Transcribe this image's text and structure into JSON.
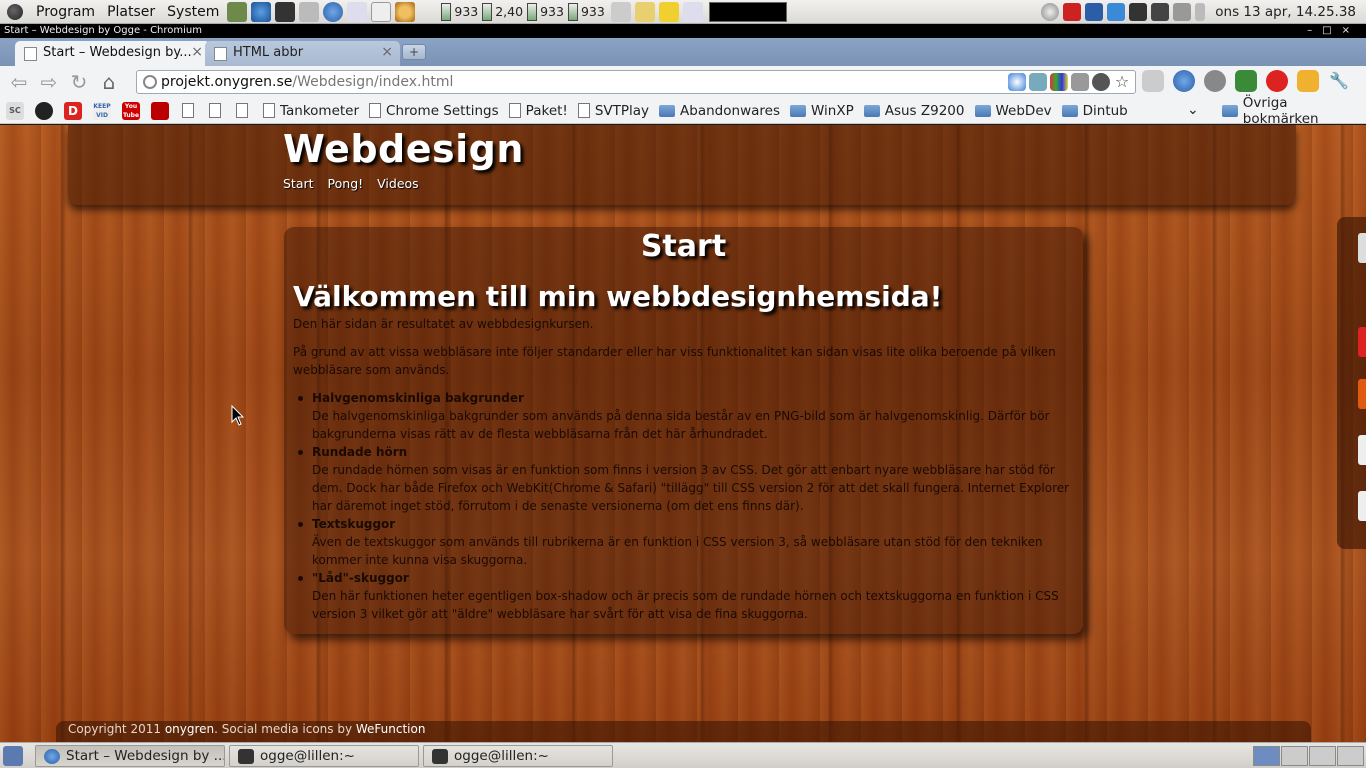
{
  "top_panel": {
    "menus": [
      "Program",
      "Platser",
      "System"
    ],
    "monitors": [
      {
        "label": "933"
      },
      {
        "label": "2,40"
      },
      {
        "label": "933"
      },
      {
        "label": "933"
      }
    ],
    "clock": "ons 13 apr, 14.25.38"
  },
  "window_title": "Start – Webdesign by Ogge - Chromium",
  "tabs": [
    {
      "label": "Start – Webdesign by...",
      "active": true
    },
    {
      "label": "HTML abbr",
      "active": false
    }
  ],
  "address_bar": {
    "host": "projekt.onygren.se",
    "path": "/Webdesign/index.html"
  },
  "bookmarks": {
    "icon_items": [
      {
        "icon": "sc-icon",
        "text": "SC"
      },
      {
        "icon": "opera-icon",
        "text": ""
      },
      {
        "icon": "d-icon",
        "text": "D"
      },
      {
        "icon": "keepvid-icon",
        "text": "KEEP VID"
      },
      {
        "icon": "youtube-icon",
        "text": "You Tube"
      },
      {
        "icon": "shield-icon",
        "text": ""
      }
    ],
    "items": [
      {
        "label": "Tankometer",
        "type": "page"
      },
      {
        "label": "Chrome Settings",
        "type": "page"
      },
      {
        "label": "Paket!",
        "type": "page"
      },
      {
        "label": "SVTPlay",
        "type": "page"
      },
      {
        "label": "Abandonwares",
        "type": "folder"
      },
      {
        "label": "WinXP",
        "type": "folder"
      },
      {
        "label": "Asus Z9200",
        "type": "folder"
      },
      {
        "label": "WebDev",
        "type": "folder"
      },
      {
        "label": "Dintub",
        "type": "folder"
      }
    ],
    "other": "Övriga bokmärken"
  },
  "site": {
    "title": "Webdesign",
    "nav": [
      "Start",
      "Pong!",
      "Videos"
    ],
    "heading": "Start",
    "welcome": "Välkommen till min webbdesignhemsida!",
    "intro": "Den här sidan är resultatet av webbdesignkursen.",
    "paragraph": "På grund av att vissa webbläsare inte följer standarder eller har viss funktionalitet kan sidan visas lite olika beroende på vilken webbläsare som används.",
    "features": [
      {
        "term": "Halvgenomskinliga bakgrunder",
        "desc": "De halvgenomskinliga bakgrunder som används på denna sida består av en PNG-bild som är halvgenomskinlig. Därför bör bakgrunderna visas rätt av de flesta webbläsarna från det här århundradet."
      },
      {
        "term": "Rundade hörn",
        "desc": "De rundade hörnen som visas är en funktion som finns i version 3 av CSS. Det gör att enbart nyare webbläsare har stöd för dem. Dock har både Firefox och WebKit(Chrome & Safari) \"tillägg\" till CSS version 2 för att det skall fungera. Internet Explorer har däremot inget stöd, förrutom i de senaste versionerna (om det ens finns där)."
      },
      {
        "term": "Textskuggor",
        "desc": "Även de textskuggor som används till rubrikerna är en funktion i CSS version 3, så webbläsare utan stöd för den tekniken kommer inte kunna visa skuggorna."
      },
      {
        "term": "\"Låd\"-skuggor",
        "desc": "Den här funktionen heter egentligen box-shadow och är precis som de rundade hörnen och textskuggorna en funktion i CSS version 3 vilket gör att \"äldre\" webbläsare har svårt för att visa de fina skuggorna."
      }
    ],
    "footer": {
      "copyright": "Copyright 2011",
      "author": "onygren",
      "credit_text": "Social media icons by",
      "credit_link": "WeFunction"
    }
  },
  "taskbar": [
    {
      "label": "Start – Webdesign by ...",
      "active": true,
      "icon": "chromium-icon"
    },
    {
      "label": "ogge@lillen:~",
      "active": false,
      "icon": "terminal-icon"
    },
    {
      "label": "ogge@lillen:~",
      "active": false,
      "icon": "terminal-icon"
    }
  ],
  "colors": {
    "wood": "#a04a18",
    "panel_dark": "#3c1604"
  }
}
